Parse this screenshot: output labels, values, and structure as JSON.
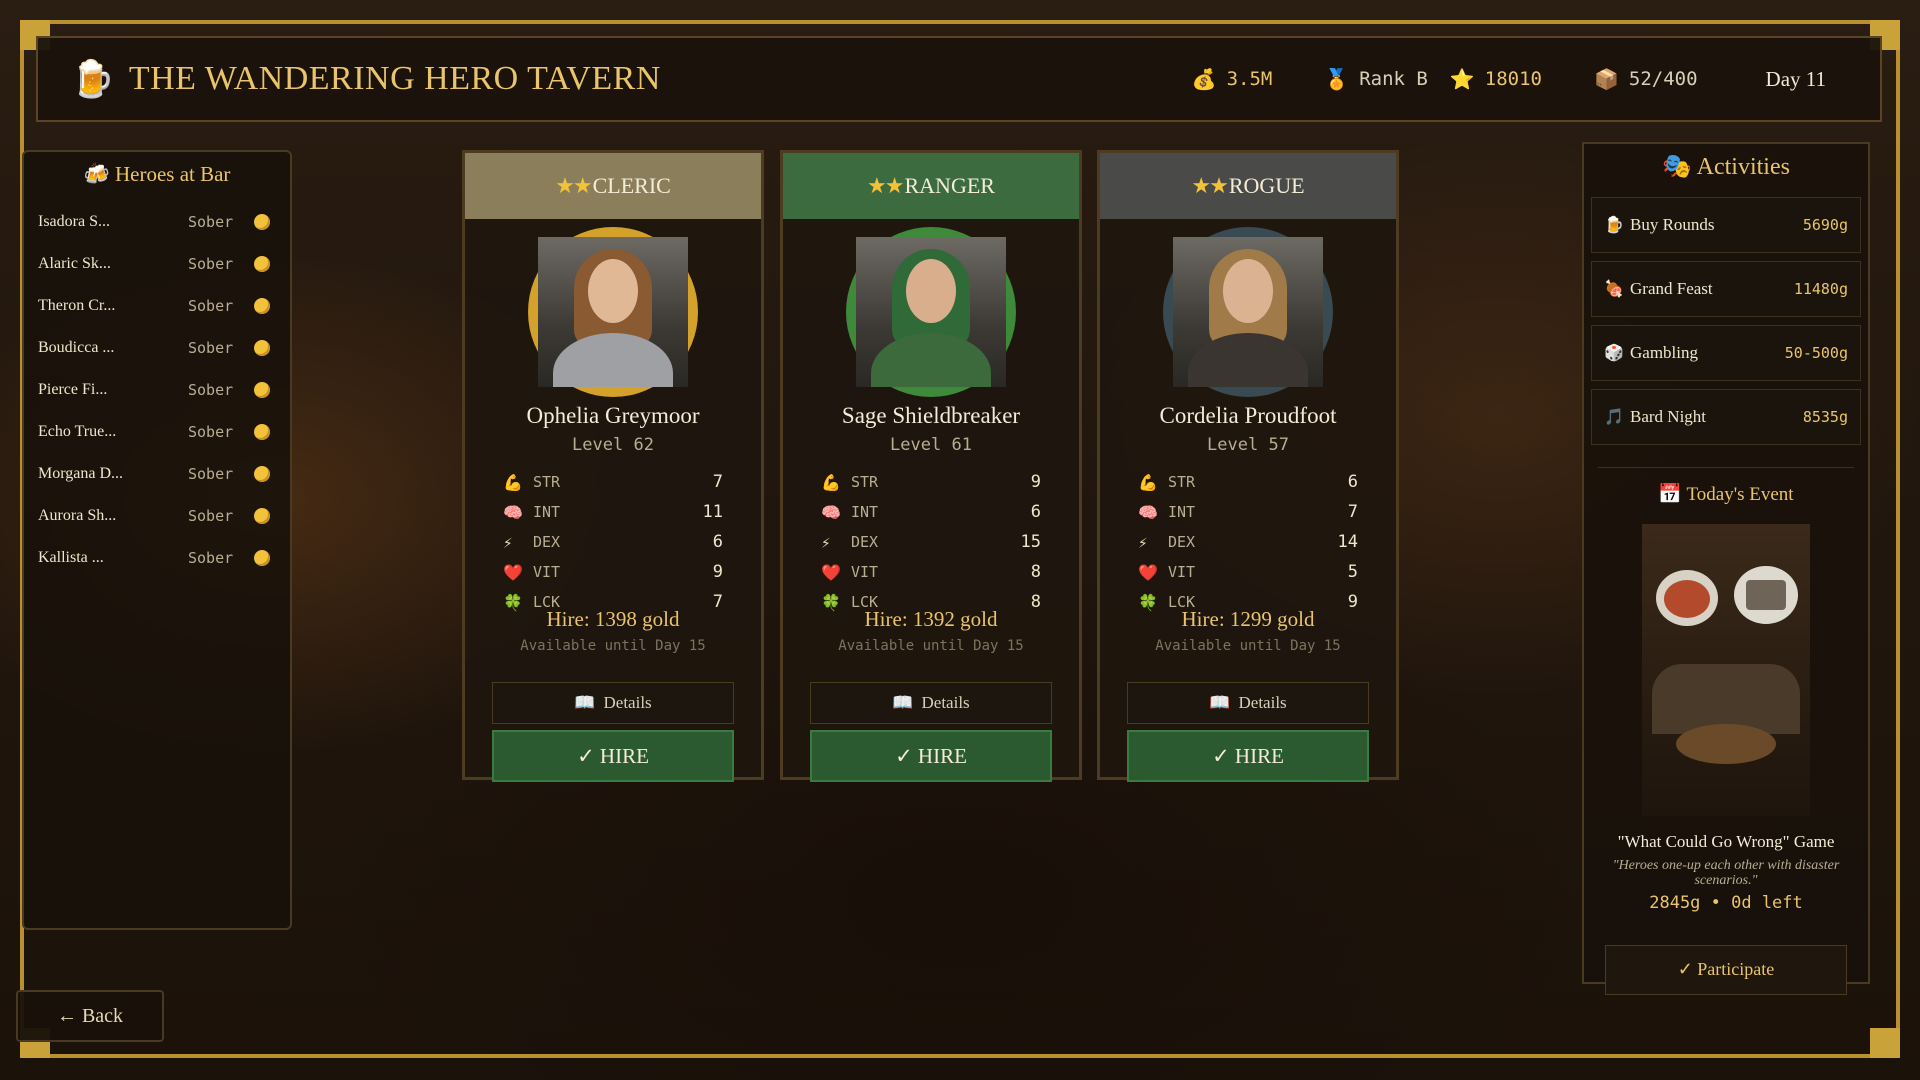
{
  "header": {
    "title": "THE WANDERING HERO TAVERN",
    "mug_icon": "beer-mug-icon",
    "gold": "3.5M",
    "rank": "Rank B",
    "reputation": "18010",
    "storage": "52/400",
    "day": "Day 11"
  },
  "bar": {
    "title": "Heroes at Bar",
    "heroes": [
      {
        "name": "Isadora S...",
        "state": "Sober"
      },
      {
        "name": "Alaric Sk...",
        "state": "Sober"
      },
      {
        "name": "Theron Cr...",
        "state": "Sober"
      },
      {
        "name": "Boudicca ...",
        "state": "Sober"
      },
      {
        "name": "Pierce Fi...",
        "state": "Sober"
      },
      {
        "name": "Echo True...",
        "state": "Sober"
      },
      {
        "name": "Morgana D...",
        "state": "Sober"
      },
      {
        "name": "Aurora Sh...",
        "state": "Sober"
      },
      {
        "name": "Kallista ...",
        "state": "Sober"
      }
    ]
  },
  "back_label": "← Back",
  "cards": [
    {
      "stars": "★★",
      "class": "CLERIC",
      "name": "Ophelia Greymoor",
      "level": "Level 62",
      "stats": [
        {
          "label": "STR",
          "value": "7"
        },
        {
          "label": "INT",
          "value": "11"
        },
        {
          "label": "DEX",
          "value": "6"
        },
        {
          "label": "VIT",
          "value": "9"
        },
        {
          "label": "LCK",
          "value": "7"
        }
      ],
      "hire_cost": "Hire: 1398 gold",
      "available": "Available until Day 15",
      "details_label": "Details",
      "hire_label": "✓ HIRE",
      "header_color": "#8a7f5a",
      "ring_color": "#d4a22a"
    },
    {
      "stars": "★★",
      "class": "RANGER",
      "name": "Sage Shieldbreaker",
      "level": "Level 61",
      "stats": [
        {
          "label": "STR",
          "value": "9"
        },
        {
          "label": "INT",
          "value": "6"
        },
        {
          "label": "DEX",
          "value": "15"
        },
        {
          "label": "VIT",
          "value": "8"
        },
        {
          "label": "LCK",
          "value": "8"
        }
      ],
      "hire_cost": "Hire: 1392 gold",
      "available": "Available until Day 15",
      "details_label": "Details",
      "hire_label": "✓ HIRE",
      "header_color": "#3d6b40",
      "ring_color": "#3f8a3a"
    },
    {
      "stars": "★★",
      "class": "ROGUE",
      "name": "Cordelia Proudfoot",
      "level": "Level 57",
      "stats": [
        {
          "label": "STR",
          "value": "6"
        },
        {
          "label": "INT",
          "value": "7"
        },
        {
          "label": "DEX",
          "value": "14"
        },
        {
          "label": "VIT",
          "value": "5"
        },
        {
          "label": "LCK",
          "value": "9"
        }
      ],
      "hire_cost": "Hire: 1299 gold",
      "available": "Available until Day 15",
      "details_label": "Details",
      "hire_label": "✓ HIRE",
      "header_color": "#4a4a48",
      "ring_color": "#3a4a52"
    }
  ],
  "activities": {
    "title": "Activities",
    "items": [
      {
        "name": "Buy Rounds",
        "cost": "5690g",
        "icon": "beer-icon"
      },
      {
        "name": "Grand Feast",
        "cost": "11480g",
        "icon": "meat-icon"
      },
      {
        "name": "Gambling",
        "cost": "50-500g",
        "icon": "dice-icon"
      },
      {
        "name": "Bard Night",
        "cost": "8535g",
        "icon": "music-note-icon"
      }
    ]
  },
  "event": {
    "title": "Today's Event",
    "name": "\"What Could Go Wrong\" Game",
    "description": "\"Heroes one-up each other with disaster scenarios.\"",
    "cost": "2845g • 0d left",
    "participate_label": "✓ Participate"
  },
  "colors": {
    "gold": "#e9c46a",
    "frame": "#b8902e",
    "hire_green": "#2b5a30"
  }
}
